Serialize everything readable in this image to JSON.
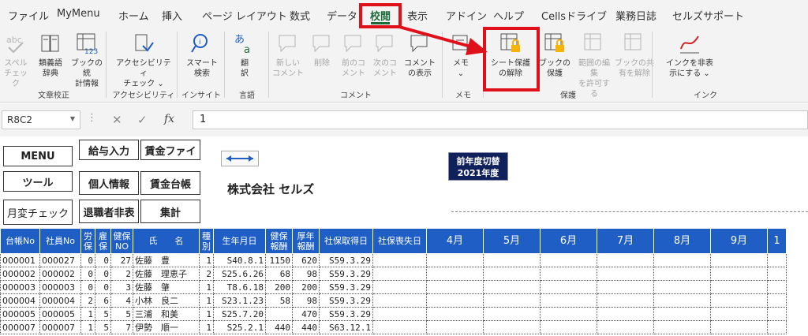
{
  "menu_tabs": [
    "ファイル",
    "MyMenu",
    "ホーム",
    "挿入",
    "ページ レイアウト",
    "数式",
    "データ",
    "校閲",
    "表示",
    "アドイン",
    "ヘルプ",
    "Cellsドライブ",
    "業務日誌",
    "セルズサポート"
  ],
  "active_tab": "校閲",
  "ribbon": {
    "buttons": [
      {
        "label": "スペル\nチェック",
        "icon": "spellcheck-icon",
        "enabled": false
      },
      {
        "label": "類義語\n辞典",
        "icon": "thesaurus-icon",
        "enabled": true
      },
      {
        "label": "ブックの統\n計情報",
        "icon": "workbook-stats-icon",
        "enabled": true
      },
      {
        "label": "アクセシビリティ\nチェック ⌄",
        "icon": "accessibility-icon",
        "enabled": true
      },
      {
        "label": "スマート\n検索",
        "icon": "smart-lookup-icon",
        "enabled": true
      },
      {
        "label": "翻\n訳",
        "icon": "translate-icon",
        "enabled": true
      },
      {
        "label": "新しい\nコメント",
        "icon": "new-comment-icon",
        "enabled": false
      },
      {
        "label": "削除",
        "icon": "delete-comment-icon",
        "enabled": false
      },
      {
        "label": "前のコ\nメント",
        "icon": "prev-comment-icon",
        "enabled": false
      },
      {
        "label": "次のコ\nメント",
        "icon": "next-comment-icon",
        "enabled": false
      },
      {
        "label": "コメント\nの表示",
        "icon": "show-comments-icon",
        "enabled": true
      },
      {
        "label": "メモ\n⌄",
        "icon": "notes-icon",
        "enabled": true
      },
      {
        "label": "シート保護\nの解除",
        "icon": "unprotect-sheet-icon",
        "enabled": true
      },
      {
        "label": "ブックの\n保護",
        "icon": "protect-workbook-icon",
        "enabled": true
      },
      {
        "label": "範囲の編集\nを許可する",
        "icon": "allow-edit-ranges-icon",
        "enabled": false
      },
      {
        "label": "ブックの共\n有を解除",
        "icon": "unshare-workbook-icon",
        "enabled": false
      },
      {
        "label": "インクを非表\n示にする ⌄",
        "icon": "hide-ink-icon",
        "enabled": true
      }
    ],
    "groups": [
      "文章校正",
      "アクセシビリティ",
      "インサイト",
      "言語",
      "コメント",
      "メモ",
      "保護",
      "インク"
    ]
  },
  "formula_bar": {
    "name_box": "R8C2",
    "formula": "1",
    "cancel_icon": "✕",
    "enter_icon": "✓",
    "fx_label": "fx"
  },
  "sheet": {
    "buttons": [
      "MENU",
      "給与入力",
      "賃金ファイ",
      "ツール",
      "個人情報",
      "賃金台帳",
      "月変チェック",
      "退職者非表",
      "集計"
    ],
    "company": "株式会社 セルズ",
    "year_button": [
      "前年度切替",
      "2021年度"
    ],
    "headers": [
      "台帳No",
      "社員No",
      "労\n保",
      "雇\n保",
      "健保\nNO",
      "氏　　名",
      "種\n別",
      "生年月日",
      "健保\n報酬",
      "厚年\n報酬",
      "社保取得日",
      "社保喪失日",
      "4月",
      "5月",
      "6月",
      "7月",
      "8月",
      "9月",
      "1"
    ],
    "rows": [
      [
        "000001",
        "000027",
        "0",
        "0",
        "27",
        "佐藤　豊",
        "1",
        "S40.8.1",
        "1150",
        "620",
        "S59.3.29"
      ],
      [
        "000002",
        "000002",
        "0",
        "0",
        "2",
        "佐藤　理恵子",
        "2",
        "S25.6.26",
        "68",
        "98",
        "S59.3.29"
      ],
      [
        "000003",
        "000003",
        "0",
        "0",
        "3",
        "佐藤　肇",
        "1",
        "T8.6.18",
        "200",
        "200",
        "S59.3.29"
      ],
      [
        "000004",
        "000004",
        "2",
        "6",
        "4",
        "小林　良二",
        "1",
        "S23.1.23",
        "58",
        "98",
        "S59.3.29"
      ],
      [
        "000005",
        "000005",
        "1",
        "5",
        "5",
        "三浦　和美",
        "1",
        "S25.7.20",
        "",
        "470",
        "S59.3.29"
      ],
      [
        "000007",
        "000007",
        "1",
        "5",
        "7",
        "伊勢　順一",
        "1",
        "S25.2.1",
        "440",
        "440",
        "S63.12.1"
      ]
    ]
  },
  "colors": {
    "accent": "#1e6b3a",
    "highlight": "#e0101a",
    "header_bg": "#1f5fc5"
  }
}
